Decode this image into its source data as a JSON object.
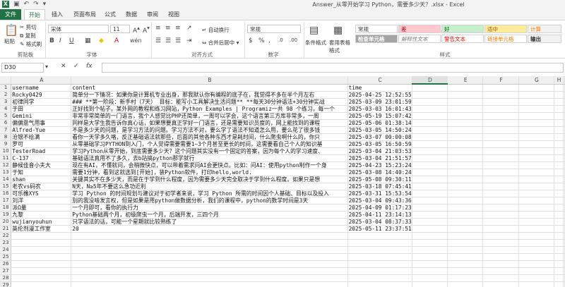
{
  "window": {
    "title": "Answer_从零开始学习 Python，需要多少天？.xlsx - Excel"
  },
  "tabs": [
    "文件",
    "开始",
    "插入",
    "页面布局",
    "公式",
    "数据",
    "审阅",
    "视图"
  ],
  "ribbon": {
    "clipboard": {
      "paste": "粘贴",
      "cut": "剪切",
      "copy": "复制",
      "format_painter": "格式刷",
      "label": "剪贴板"
    },
    "font": {
      "name": "宋体",
      "size": "11",
      "label": "字体"
    },
    "alignment": {
      "wrap": "自动换行",
      "merge": "合并后居中",
      "label": "对齐方式"
    },
    "number": {
      "format": "常规",
      "label": "数字"
    },
    "styles": {
      "cond": "条件格式",
      "table": "套用表格格式",
      "cells": [
        "常规",
        "差",
        "好",
        "适中",
        "计算",
        "检查单元格",
        "解释性文本",
        "警告文本",
        "链接单元格",
        "输出"
      ],
      "label": "样式"
    }
  },
  "formula_bar": {
    "name_box": "D30",
    "formula": ""
  },
  "columns": [
    "A",
    "B",
    "C",
    "D",
    "E",
    "F",
    "G",
    "H"
  ],
  "active_column": "D",
  "rows": [
    [
      "1",
      "username",
      "content",
      "time"
    ],
    [
      "2",
      "Rocky0429",
      "简单分一下情况：如果你是计算机专业出身，那我默认你有编程的底子在，我觉得不多在半个月左右",
      "2025-04-25 12:52:55"
    ],
    [
      "3",
      "初律同学",
      "### **第一阶段：新手村（7天）  目标：能写小工具解决生活问题**  **每天30分钟语法+30分钟实战",
      "2025-03-09 23:01:59"
    ],
    [
      "4",
      "于田",
      "正好找到个帖子。某外网的教程和练习网站，Python Examples | Programiz一共 98 个练习，每一个",
      "2025-03-03 16:01:43"
    ],
    [
      "5",
      "Gemini",
      "非常非常简单的一门语言，我个人感觉比PHP还简单，一周可以学会，这个语言第三方库非常多，一周",
      "2025-05-19 15:07:42"
    ],
    [
      "6",
      "偏偏意气用事",
      "同样是大学生我告诉你真心话，如果想要真正学好一门语言，还是需要知识员度的，网上能找到的课程",
      "2025-05-06 01:38:14"
    ],
    [
      "7",
      "Alfred-Yue",
      "不是多少天的问题，是学习方法的问题。学习方法不对，要么学了语法不知道怎么用，要么花了很多钱",
      "2025-03-05 14:50:24"
    ],
    [
      "8",
      "沧银不绘满",
      "看你一天学多久咯，反正基础语法就那些，后面的其他各种东西才是耗时间，什么爬虫啊什么的，你只",
      "2025-03-07 00:00:08"
    ],
    [
      "9",
      "罗可",
      "从零基础学习PYTHON到入门，个人觉得需要需要1~3个月甚至更长的时间，这需要看自己个人的知识基",
      "2025-03-05 16:50:59"
    ],
    [
      "10",
      "TesterRoad",
      "学习Python从零开始，到底需要多少天？这个问题其实没有一个固定的答案，因为每个人的学习速度、",
      "2025-03-04 21:03:53"
    ],
    [
      "11",
      "C-137",
      "基础语法真用不了多久，去b站搞python那学就行",
      "2025-03-04 21:51:57"
    ],
    [
      "12",
      "静候佳音小夫大",
      "现在有AI，不懂就问，会稍微快点，可以带着需求问AI会更快点。比如：问AI：使用python制作一个身",
      "2025-04-23 15:23:24"
    ],
    [
      "13",
      "于知",
      "需要1分钟，看到这就选到[开始]，装Python软件，打印hello,world.",
      "2025-03-08 14:40:24"
    ],
    [
      "14",
      "shan",
      "关键其实不在多少天，而是在于学到什么程度，因为需要多少天完全取决于学到什么程度。如果只是想",
      "2025-05-08 09:30:11"
    ],
    [
      "15",
      "老农vs码农",
      "N天，N≥5年不要这么急功近利",
      "2025-03-18 07:45:41"
    ],
    [
      "16",
      "可乐橡XYS",
      "学习 Python 的时间规划与建议对于初学者来说，学习 Python 所需的时间因个人基础、目标以及投入",
      "2025-03-31 15:53:54"
    ],
    [
      "17",
      "刘洋",
      "别的我没啥发言权，但是如果是用python做数据分析，我们的课程中，python的数学时间是3天",
      "2025-03-04 09:43:36"
    ],
    [
      "18",
      "派Ω量",
      "一个月即可，看你的执行力",
      "2025-04-09 01:17:23"
    ],
    [
      "19",
      "九黎",
      "Python基础两个月，初级爬虫一个月，后端开发，三四个月",
      "2025-04-11 23:14:13"
    ],
    [
      "20",
      "wujianyouhun",
      "只学语法的话，可能一个星期就比较熟练了",
      "2025-03-04 08:37:33"
    ],
    [
      "21",
      "英伦剂漫工作室",
      "20",
      "2025-05-11 23:37:51"
    ],
    [
      "22",
      "",
      "",
      ""
    ],
    [
      "23",
      "",
      "",
      ""
    ],
    [
      "24",
      "",
      "",
      ""
    ],
    [
      "25",
      "",
      "",
      ""
    ],
    [
      "26",
      "",
      "",
      ""
    ],
    [
      "27",
      "",
      "",
      ""
    ],
    [
      "28",
      "",
      "",
      ""
    ],
    [
      "29",
      "",
      "",
      ""
    ]
  ]
}
